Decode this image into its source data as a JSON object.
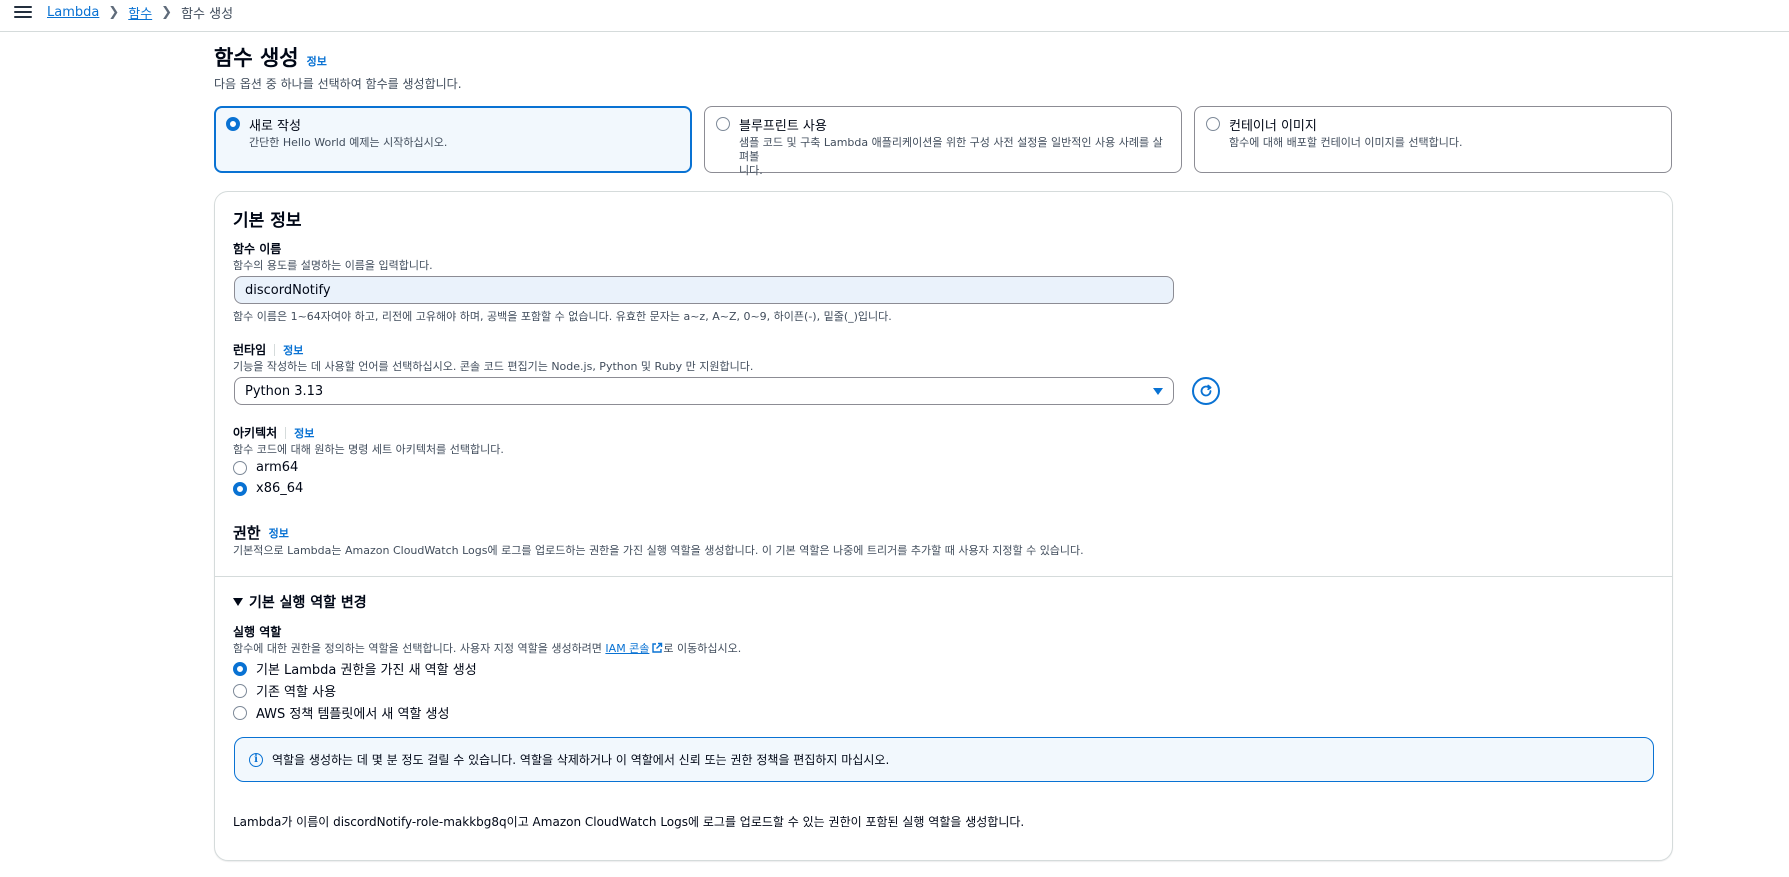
{
  "breadcrumbs": [
    {
      "label": "Lambda"
    },
    {
      "label": "함수"
    },
    {
      "label": "함수 생성"
    }
  ],
  "header": {
    "title": "함수 생성",
    "info": "정보",
    "subtitle": "다음 옵션 중 하나를 선택하여 함수를 생성합니다."
  },
  "options": [
    {
      "title": "새로 작성",
      "desc": "간단한 Hello World 예제는 시작하십시오.",
      "selected": true
    },
    {
      "title": "블루프린트 사용",
      "desc_line1": "샘플 코드 및 구축 Lambda 애플리케이션을 위한 구성 사전 설정을 일반적인 사용 사례를 살펴볼",
      "desc_line2": "니다.",
      "selected": false
    },
    {
      "title": "컨테이너 이미지",
      "desc": "함수에 대해 배포할 컨테이너 이미지를 선택합니다.",
      "selected": false
    }
  ],
  "basic": {
    "title": "기본 정보",
    "function_name": {
      "label": "함수 이름",
      "desc": "함수의 용도를 설명하는 이름을 입력합니다.",
      "value": "discordNotify",
      "hint": "함수 이름은 1~64자여야 하고, 리전에 고유해야 하며, 공백을 포함할 수 없습니다. 유효한 문자는 a~z, A~Z, 0~9, 하이픈(-), 밑줄(_)입니다."
    },
    "runtime": {
      "label": "런타임",
      "info": "정보",
      "desc": "기능을 작성하는 데 사용할 언어를 선택하십시오. 콘솔 코드 편집기는 Node.js, Python 및 Ruby 만 지원합니다.",
      "value": "Python 3.13"
    },
    "architecture": {
      "label": "아키텍처",
      "info": "정보",
      "desc": "함수 코드에 대해 원하는 명령 세트 아키텍처를 선택합니다.",
      "options": [
        {
          "label": "arm64",
          "selected": false
        },
        {
          "label": "x86_64",
          "selected": true
        }
      ]
    },
    "permissions": {
      "label": "권한",
      "info": "정보",
      "desc": "기본적으로 Lambda는 Amazon CloudWatch Logs에 로그를 업로드하는 권한을 가진 실행 역할을 생성합니다. 이 기본 역할은 나중에 트리거를 추가할 때 사용자 지정할 수 있습니다."
    }
  },
  "execution_role": {
    "expander": "기본 실행 역할 변경",
    "label": "실행 역할",
    "desc_before": "함수에 대한 권한을 정의하는 역할을 선택합니다. 사용자 지정 역할을 생성하려면 ",
    "desc_link": "IAM 콘솔",
    "desc_after": "로 이동하십시오.",
    "options": [
      {
        "label": "기본 Lambda 권한을 가진 새 역할 생성",
        "selected": true
      },
      {
        "label": "기존 역할 사용",
        "selected": false
      },
      {
        "label": "AWS 정책 템플릿에서 새 역할 생성",
        "selected": false
      }
    ],
    "alert": "역할을 생성하는 데 몇 분 정도 걸릴 수 있습니다. 역할을 삭제하거나 이 역할에서 신뢰 또는 권한 정책을 편집하지 마십시오.",
    "summary": "Lambda가 이름이 discordNotify-role-makkbg8q이고 Amazon CloudWatch Logs에 로그를 업로드할 수 있는 권한이 포함된 실행 역할을 생성합니다."
  },
  "colors": {
    "accent": "#0972d3",
    "text": "#000716",
    "muted": "#414d5c",
    "border": "#d5dbdb"
  }
}
